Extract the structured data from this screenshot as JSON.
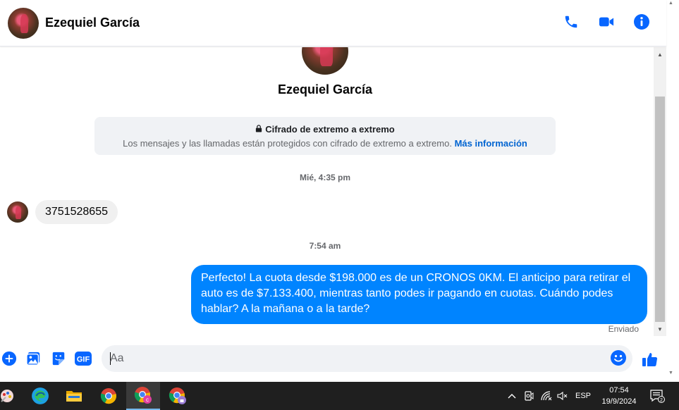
{
  "header": {
    "contact_name": "Ezequiel García",
    "icons": [
      "phone-icon",
      "video-camera-icon",
      "info-icon"
    ]
  },
  "chat": {
    "profile_name": "Ezequiel García",
    "encryption": {
      "title": "Cifrado de extremo a extremo",
      "body": "Los mensajes y las llamadas están protegidos con cifrado de extremo a extremo.",
      "link": "Más información"
    },
    "timestamps": [
      "Mié, 4:35 pm",
      "7:54 am"
    ],
    "messages": [
      {
        "direction": "incoming",
        "text": "3751528655"
      },
      {
        "direction": "outgoing",
        "text": "Perfecto! La cuota desde $198.000 es de un CRONOS 0KM. El anticipo para retirar el auto es de $7.133.400, mientras tanto podes ir pagando en cuotas. Cuándo podes hablar? A la mañana o a la tarde?"
      }
    ],
    "sent_status": "Enviado"
  },
  "composer": {
    "placeholder": "Aa",
    "gif_label": "GIF"
  },
  "taskbar": {
    "language": "ESP",
    "time": "07:54",
    "date": "19/9/2024",
    "notification_count": "2"
  },
  "colors": {
    "accent": "#0084ff",
    "icon_blue": "#0866ff",
    "incoming_bubble": "#f0f0f0",
    "taskbar": "#1f1f1f"
  }
}
